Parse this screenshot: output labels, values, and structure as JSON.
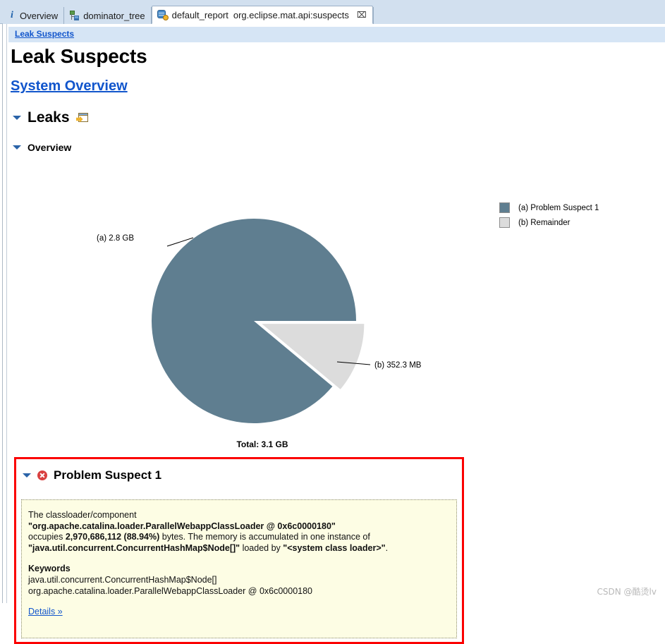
{
  "window": {
    "tabs": [
      {
        "label": "Overview",
        "subtitle": "",
        "icon": "info-icon",
        "active": false,
        "closable": false
      },
      {
        "label": "dominator_tree",
        "subtitle": "",
        "icon": "tree-icon",
        "active": false,
        "closable": false
      },
      {
        "label": "default_report",
        "subtitle": "org.eclipse.mat.api:suspects",
        "icon": "report-icon",
        "active": true,
        "closable": true,
        "close_glyph": "⌧"
      }
    ]
  },
  "breadcrumb": {
    "label": "Leak Suspects"
  },
  "page": {
    "title": "Leak Suspects",
    "system_overview_link": "System Overview",
    "leaks_section_title": "Leaks",
    "overview_section_title": "Overview"
  },
  "chart_data": {
    "type": "pie",
    "title": "",
    "total_label": "Total: 3.1 GB",
    "total_value": "3.1 GB",
    "legend_position": "right",
    "slices": [
      {
        "key": "(a)",
        "name": "Problem Suspect 1",
        "value_label": "2.8 GB",
        "legend_label": "(a)  Problem Suspect 1",
        "callout_label": "(a)  2.8 GB",
        "percent": 88.94,
        "color": "#5f7e90",
        "exploded": false
      },
      {
        "key": "(b)",
        "name": "Remainder",
        "value_label": "352.3 MB",
        "legend_label": "(b)  Remainder",
        "callout_label": "(b)  352.3 MB",
        "percent": 11.06,
        "color": "#dcdcdc",
        "exploded": true
      }
    ]
  },
  "suspect": {
    "title": "Problem Suspect 1",
    "status_icon": "error-icon",
    "description_line1": "The classloader/component",
    "classloader_name": "\"org.apache.catalina.loader.ParallelWebappClassLoader @ 0x6c0000180\"",
    "occupies_word": "occupies",
    "bytes_bold": "2,970,686,112 (88.94%)",
    "middle_text": "bytes. The memory is accumulated in one instance of",
    "instance_bold": "\"java.util.concurrent.ConcurrentHashMap$Node[]\"",
    "loaded_by_word": "loaded by",
    "loader_bold": "\"<system class loader>\"",
    "trailing_period": ".",
    "keywords_title": "Keywords",
    "keywords": [
      "java.util.concurrent.ConcurrentHashMap$Node[]",
      "org.apache.catalina.loader.ParallelWebappClassLoader @ 0x6c0000180"
    ],
    "details_link": "Details »"
  },
  "watermark": {
    "text": "CSDN @酷烫lv"
  },
  "colors": {
    "accent_link": "#1155cc",
    "highlight_border": "#fb0000",
    "panel_bg": "#fdfde4",
    "chart_primary": "#5f7e90",
    "chart_secondary": "#dcdcdc",
    "tabbar_bg": "#d2e0ef",
    "breadcrumb_bg": "#d6e5f5"
  }
}
